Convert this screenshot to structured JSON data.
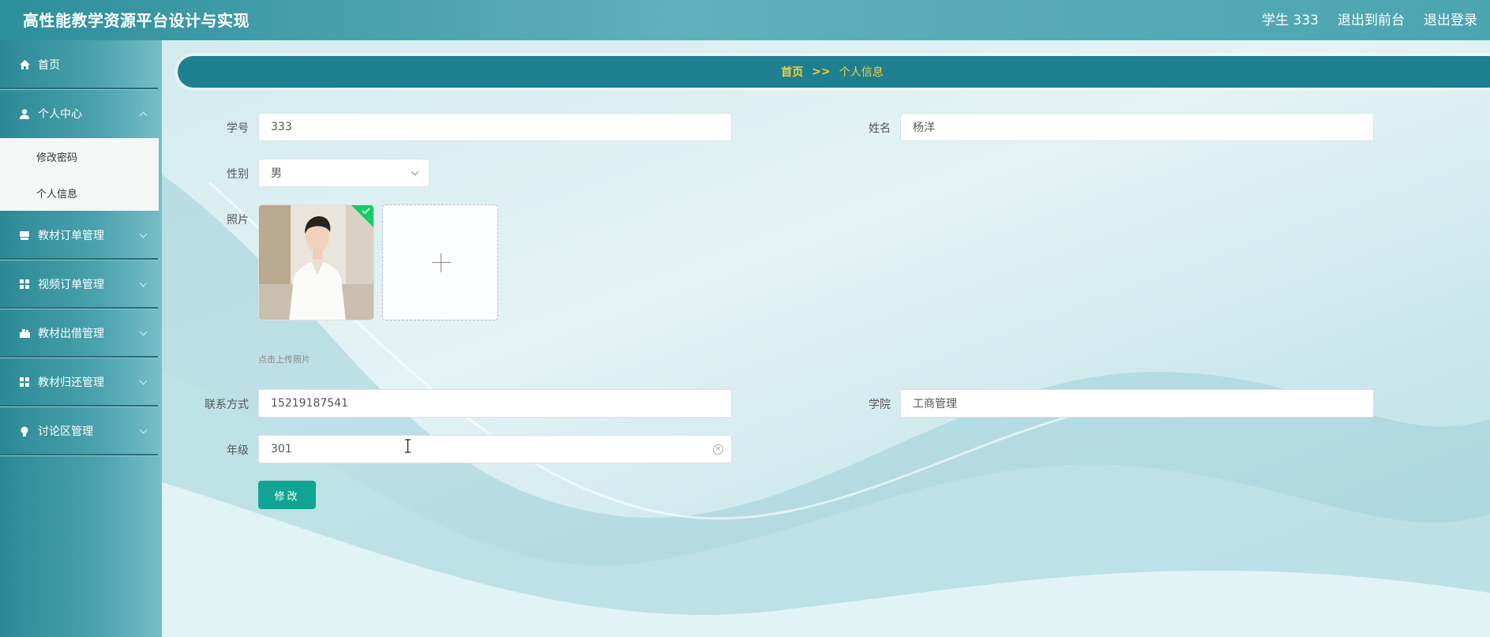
{
  "header": {
    "app_title": "高性能教学资源平台设计与实现",
    "user_label": "学生 333",
    "back_to_front": "退出到前台",
    "logout": "退出登录"
  },
  "sidebar": {
    "items": [
      {
        "label": "首页",
        "icon": "home-icon"
      },
      {
        "label": "个人中心",
        "icon": "user-icon",
        "expanded": true
      },
      {
        "label": "教材订单管理",
        "icon": "book-icon"
      },
      {
        "label": "视频订单管理",
        "icon": "grid-icon"
      },
      {
        "label": "教材出借管理",
        "icon": "lend-icon"
      },
      {
        "label": "教材归还管理",
        "icon": "grid-icon"
      },
      {
        "label": "讨论区管理",
        "icon": "bulb-icon"
      }
    ],
    "submenu": [
      {
        "label": "修改密码"
      },
      {
        "label": "个人信息"
      }
    ]
  },
  "breadcrumb": {
    "home": "首页",
    "separator": ">>",
    "current": "个人信息"
  },
  "form": {
    "student_id_label": "学号",
    "student_id_value": "333",
    "name_label": "姓名",
    "name_value": "杨洋",
    "gender_label": "性别",
    "gender_value": "男",
    "photo_label": "照片",
    "upload_tip": "点击上传照片",
    "phone_label": "联系方式",
    "phone_value": "15219187541",
    "college_label": "学院",
    "college_value": "工商管理",
    "grade_label": "年级",
    "grade_value": "301",
    "submit_label": "修改"
  },
  "colors": {
    "header_bg": "#4ba5b1",
    "breadcrumb_bg": "#1e7f8f",
    "breadcrumb_text": "#f4d03f",
    "primary_button": "#13a593",
    "upload_success": "#13ce66"
  }
}
